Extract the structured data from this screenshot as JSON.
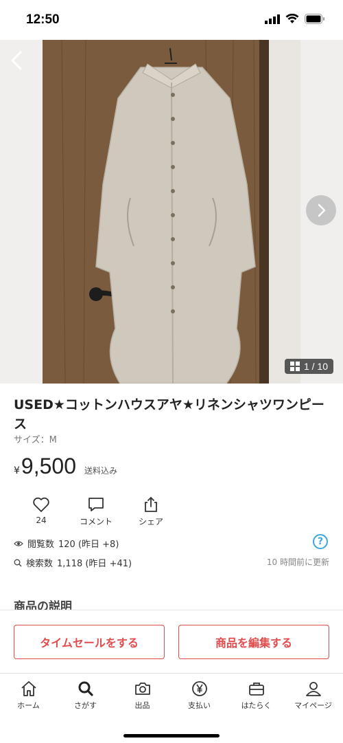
{
  "status_bar": {
    "time": "12:50"
  },
  "carousel": {
    "counter": "1 / 10"
  },
  "product": {
    "title": "USED★コットンハウスアヤ★リネンシャツワンピース",
    "size_label": "サイズ：M",
    "currency": "¥",
    "price": "9,500",
    "shipping": "送料込み"
  },
  "actions": {
    "like_count": "24",
    "comment_label": "コメント",
    "share_label": "シェア"
  },
  "stats": {
    "views_label": "閲覧数",
    "views_value": "120 (昨日 +8)",
    "search_label": "検索数",
    "search_value": "1,118 (昨日 +41)",
    "help": "?",
    "updated": "10 時間前に更新"
  },
  "description": {
    "heading": "商品の説明"
  },
  "buttons": {
    "time_sale": "タイムセールをする",
    "edit_item": "商品を編集する"
  },
  "tabs": [
    {
      "label": "ホーム",
      "icon": "home-icon"
    },
    {
      "label": "さがす",
      "icon": "search-icon"
    },
    {
      "label": "出品",
      "icon": "camera-icon"
    },
    {
      "label": "支払い",
      "icon": "yen-icon"
    },
    {
      "label": "はたらく",
      "icon": "briefcase-icon"
    },
    {
      "label": "マイページ",
      "icon": "person-icon"
    }
  ],
  "colors": {
    "accent": "#e04b4b",
    "help": "#3da6e0"
  }
}
